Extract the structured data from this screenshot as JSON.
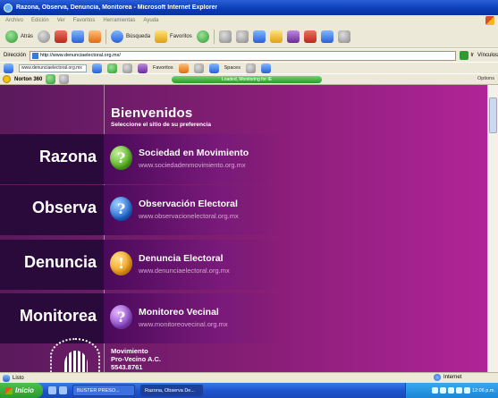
{
  "window": {
    "title": "Razona, Observa, Denuncia, Monitorea - Microsoft Internet Explorer"
  },
  "menubar": {
    "items": [
      "Archivo",
      "Edición",
      "Ver",
      "Favoritos",
      "Herramientas",
      "Ayuda"
    ]
  },
  "toolbar": {
    "back_label": "Atrás",
    "search_label": "Búsqueda",
    "favorites_label": "Favoritos"
  },
  "addressbar": {
    "label": "Dirección",
    "url": "http://www.denunciaelectoral.org.mx/",
    "go_label": "Ir",
    "links_label": "Vínculos"
  },
  "linksbar": {
    "search_value": "www.denunciaelectoral.org.mx",
    "favorites_label": "Favoritos",
    "spaces_label": "Spaces"
  },
  "norton": {
    "label": "Norton 360",
    "progress_text": "Loaded, Monitoring for IE",
    "options_label": "Options"
  },
  "page": {
    "welcome_title": "Bienvenidos",
    "welcome_subtitle": "Seleccione el sitio de su preferencia",
    "rows": [
      {
        "category": "Razona",
        "bubble": "?",
        "site_name": "Sociedad en Movimiento",
        "site_url": "www.sociedadenmovimiento.org.mx",
        "color": "#4fb01a"
      },
      {
        "category": "Observa",
        "bubble": "?",
        "site_name": "Observación Electoral",
        "site_url": "www.observacionelectoral.org.mx",
        "color": "#1a66d6"
      },
      {
        "category": "Denuncia",
        "bubble": "!",
        "site_name": "Denuncia Electoral",
        "site_url": "www.denunciaelectoral.org.mx",
        "color": "#f09a10"
      },
      {
        "category": "Monitorea",
        "bubble": "?",
        "site_name": "Monitoreo Vecinal",
        "site_url": "www.monitoreovecinal.org.mx",
        "color": "#8a40c8"
      }
    ],
    "footer": {
      "line1": "Movimiento",
      "line2": "Pro-Vecino A.C.",
      "line3": "5543.8761"
    }
  },
  "statusbar": {
    "text": "Listo",
    "zone": "Internet"
  },
  "taskbar": {
    "start_label": "Inicio",
    "tasks": [
      "BUSTER PRESO...",
      "Razona, Observa De..."
    ],
    "clock": "12:06 p.m."
  },
  "colors": {
    "page_left": "#5a1a5c",
    "page_right": "#b3249a",
    "band": "#2a0a3a",
    "url_text": "#d9a6d4",
    "titlebar": "#0a3bb4"
  }
}
